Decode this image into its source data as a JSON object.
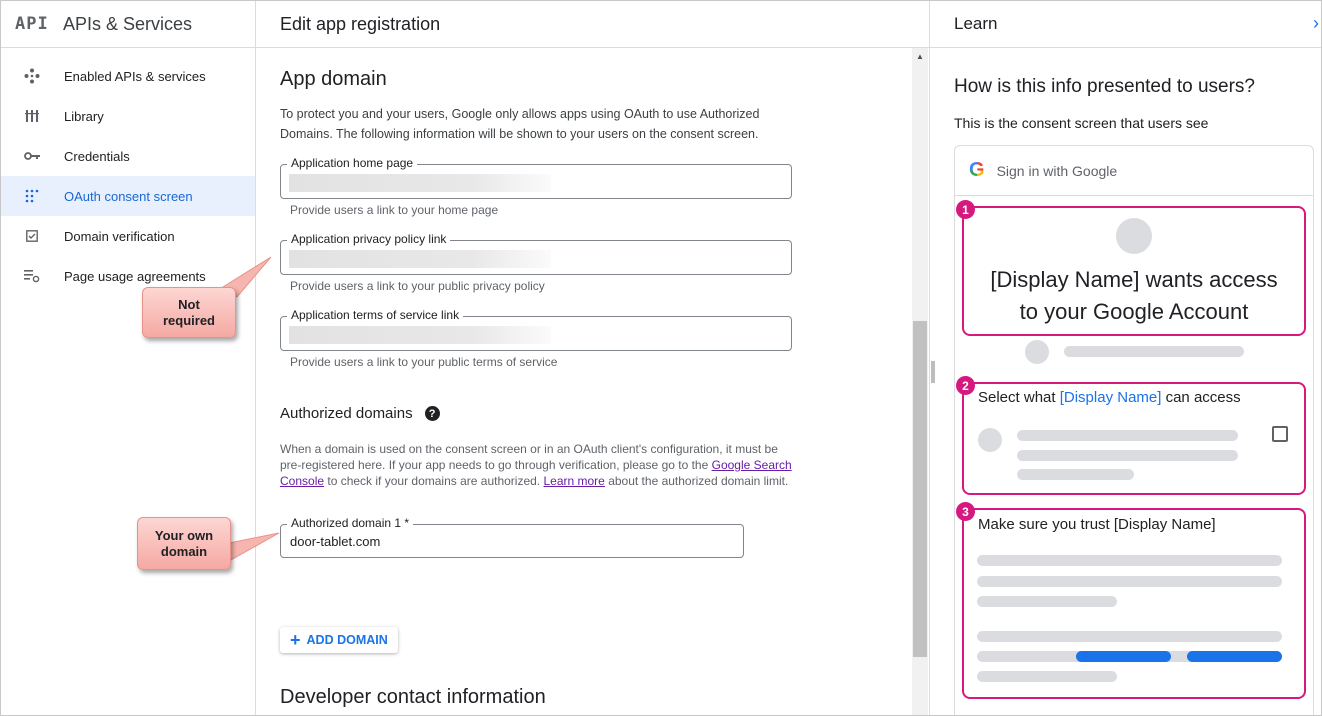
{
  "sidebar": {
    "logo": "API",
    "title": "APIs & Services",
    "items": [
      {
        "label": "Enabled APIs & services",
        "icon": "diamond-dots-icon",
        "active": false
      },
      {
        "label": "Library",
        "icon": "library-icon",
        "active": false
      },
      {
        "label": "Credentials",
        "icon": "key-icon",
        "active": false
      },
      {
        "label": "OAuth consent screen",
        "icon": "dot-grid-icon",
        "active": true
      },
      {
        "label": "Domain verification",
        "icon": "checkbox-icon",
        "active": false
      },
      {
        "label": "Page usage agreements",
        "icon": "list-settings-icon",
        "active": false
      }
    ]
  },
  "main": {
    "header": "Edit app registration",
    "app_domain_title": "App domain",
    "app_domain_desc": "To protect you and your users, Google only allows apps using OAuth to use Authorized Domains. The following information will be shown to your users on the consent screen.",
    "fields": {
      "home_label": "Application home page",
      "home_hint": "Provide users a link to your home page",
      "privacy_label": "Application privacy policy link",
      "privacy_hint": "Provide users a link to your public privacy policy",
      "terms_label": "Application terms of service link",
      "terms_hint": "Provide users a link to your public terms of service"
    },
    "authorized_domains_title": "Authorized domains",
    "auth_desc_1": "When a domain is used on the consent screen or in an OAuth client's configuration, it must be pre-registered here. If your app needs to go through verification, please go to the ",
    "auth_link_1": "Google Search Console",
    "auth_desc_2": " to check if your domains are authorized. ",
    "auth_link_2": "Learn more",
    "auth_desc_3": " about the authorized domain limit.",
    "domain_label": "Authorized domain 1 *",
    "domain_value": "door-tablet.com",
    "add_domain": "ADD DOMAIN",
    "developer_title": "Developer contact information"
  },
  "callouts": {
    "not_required_1": "Not",
    "not_required_2": "required",
    "own_domain_1": "Your own",
    "own_domain_2": "domain"
  },
  "right": {
    "header": "Learn",
    "question": "How is this info presented to users?",
    "subtitle": "This is the consent screen that users see",
    "signin": "Sign in with Google",
    "g_letter": "G",
    "box1_num": "1",
    "box1_line1": "[Display Name] wants access",
    "box1_line2": "to your Google Account",
    "box2_num": "2",
    "box2_pre": "Select what ",
    "box2_acc": "[Display Name]",
    "box2_post": " can access",
    "box3_num": "3",
    "box3_title": "Make sure you trust [Display Name]"
  },
  "colors": {
    "accent": "#1a73e8",
    "highlight": "#d6197f",
    "active_bg": "#e8f0fe"
  }
}
